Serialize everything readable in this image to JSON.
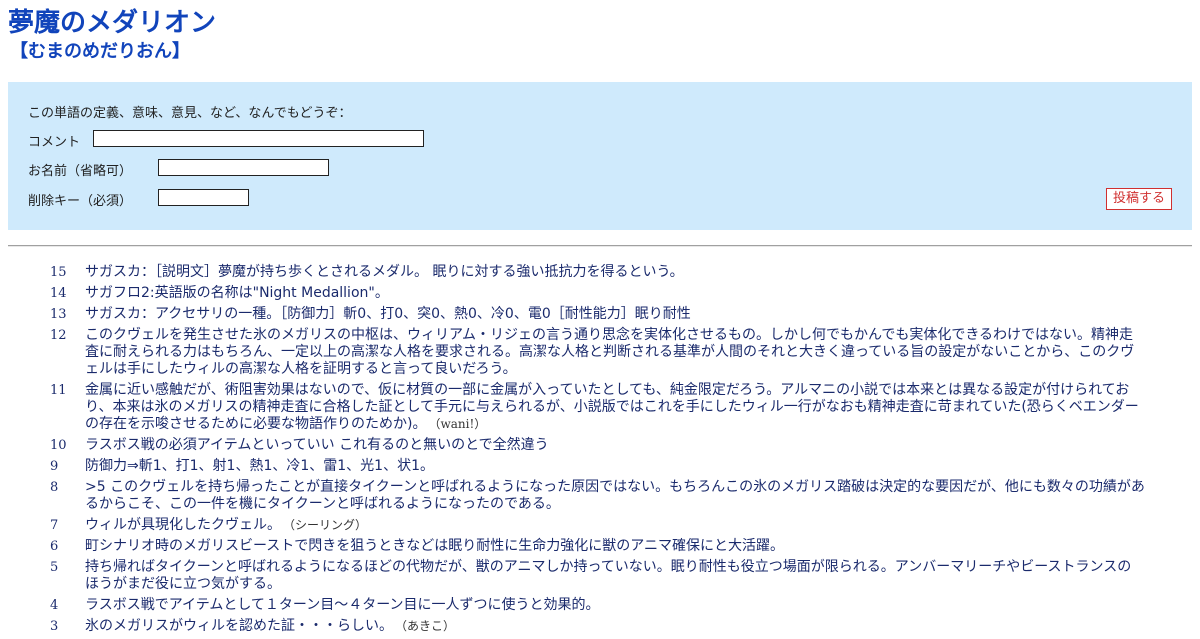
{
  "page": {
    "title": "夢魔のメダリオン",
    "reading": "【むまのめだりおん】"
  },
  "form": {
    "prompt": "この単語の定義、意味、意見、など、なんでもどうぞ：",
    "comment_label": "コメント",
    "comment_value": "",
    "name_label": "お名前（省略可）",
    "name_value": "",
    "delete_key_label": "削除キー（必須）",
    "delete_key_value": "",
    "submit_label": "投稿する"
  },
  "comments": [
    {
      "num": "15",
      "text": "サガスカ：［説明文］夢魔が持ち歩くとされるメダル。 眠りに対する強い抵抗力を得るという。",
      "author": ""
    },
    {
      "num": "14",
      "text": "サガフロ2:英語版の名称は\"Night Medallion\"。",
      "author": ""
    },
    {
      "num": "13",
      "text": "サガスカ：アクセサリの一種。［防御力］斬0、打0、突0、熱0、冷0、電0［耐性能力］眠り耐性",
      "author": ""
    },
    {
      "num": "12",
      "text": "このクヴェルを発生させた氷のメガリスの中枢は、ウィリアム・リジェの言う通り思念を実体化させるもの。しかし何でもかんでも実体化できるわけではない。精神走査に耐えられる力はもちろん、一定以上の高潔な人格を要求される。高潔な人格と判断される基準が人間のそれと大きく違っている旨の設定がないことから、このクヴェルは手にしたウィルの高潔な人格を証明すると言って良いだろう。",
      "author": ""
    },
    {
      "num": "11",
      "text": "金属に近い感触だが、術阻害効果はないので、仮に材質の一部に金属が入っていたとしても、純金限定だろう。アルマニの小説では本来とは異なる設定が付けられており、本来は氷のメガリスの精神走査に合格した証として手元に与えられるが、小説版ではこれを手にしたウィル一行がなおも精神走査に苛まれていた(恐らくベエンダーの存在を示唆させるために必要な物語作りのためか)。",
      "author": "（wani!）"
    },
    {
      "num": "10",
      "text": "ラスボス戦の必須アイテムといっていい これ有るのと無いのとで全然違う",
      "author": ""
    },
    {
      "num": "9",
      "text": "防御力⇒斬1、打1、射1、熱1、冷1、雷1、光1、状1。",
      "author": ""
    },
    {
      "num": "8",
      "text": ">5 このクヴェルを持ち帰ったことが直接タイクーンと呼ばれるようになった原因ではない。もちろんこの氷のメガリス踏破は決定的な要因だが、他にも数々の功績があるからこそ、この一件を機にタイクーンと呼ばれるようになったのである。",
      "author": ""
    },
    {
      "num": "7",
      "text": "ウィルが具現化したクヴェル。",
      "author": "（シーリング）"
    },
    {
      "num": "6",
      "text": "町シナリオ時のメガリスビーストで閃きを狙うときなどは眠り耐性に生命力強化に獣のアニマ確保にと大活躍。",
      "author": ""
    },
    {
      "num": "5",
      "text": "持ち帰ればタイクーンと呼ばれるようになるほどの代物だが、獣のアニマしか持っていない。眠り耐性も役立つ場面が限られる。アンバーマリーチやビーストランスのほうがまだ役に立つ気がする。",
      "author": ""
    },
    {
      "num": "4",
      "text": "ラスボス戦でアイテムとして１ターン目～４ターン目に一人ずつに使うと効果的。",
      "author": ""
    },
    {
      "num": "3",
      "text": "氷のメガリスがウィルを認めた証・・・らしい。",
      "author": "（あきこ）"
    }
  ]
}
